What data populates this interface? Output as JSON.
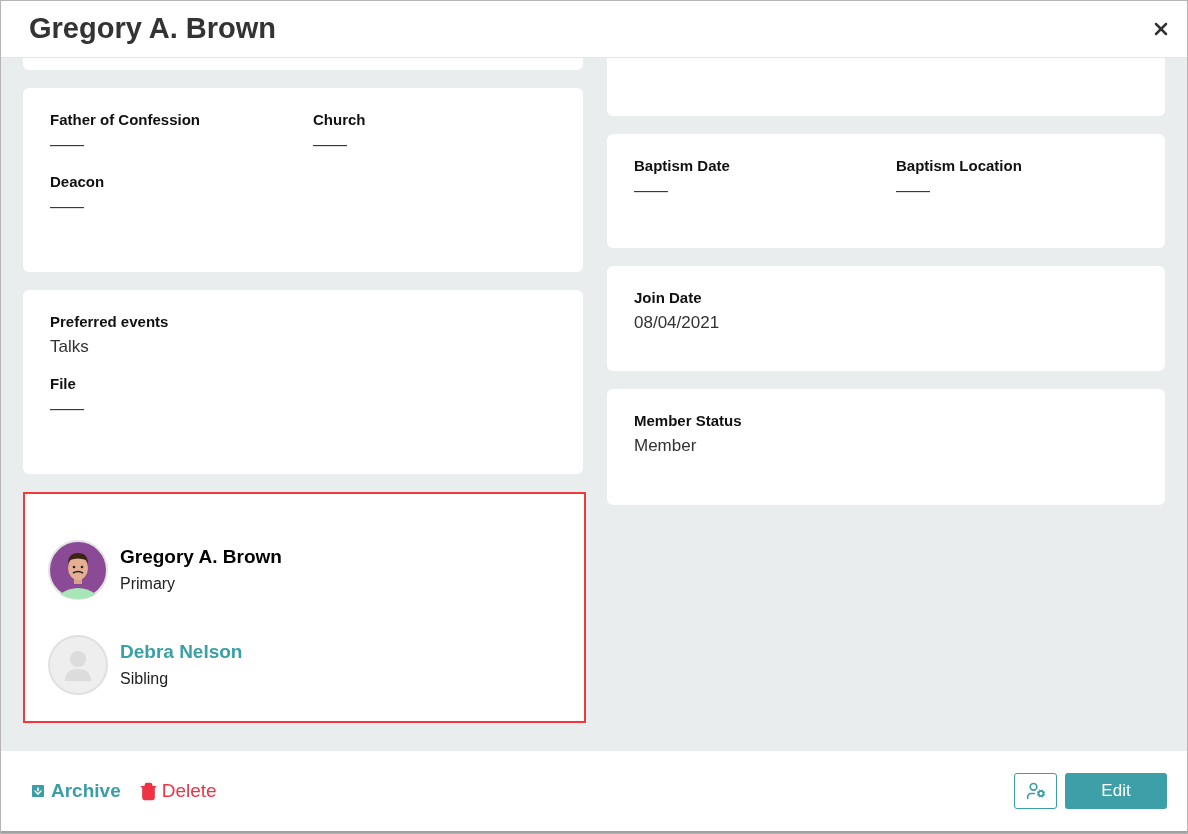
{
  "title": "Gregory A. Brown",
  "left_cards": [
    {
      "rows": [
        [
          {
            "label": "Father of Confession",
            "value": "——"
          },
          {
            "label": "Church",
            "value": "——"
          }
        ],
        [
          {
            "label": "Deacon",
            "value": "——"
          }
        ]
      ]
    },
    {
      "rows": [
        [
          {
            "label": "Preferred events",
            "value": "Talks"
          }
        ],
        [
          {
            "label": "File",
            "value": "——"
          }
        ]
      ]
    }
  ],
  "family": {
    "highlighted": true,
    "members": [
      {
        "name": "Gregory A. Brown",
        "relation": "Primary",
        "kind": "illustrated",
        "link": false
      },
      {
        "name": "Debra Nelson",
        "relation": "Sibling",
        "kind": "placeholder",
        "link": true
      }
    ]
  },
  "right_cards": [
    {
      "rows": [
        [
          {
            "label": "Baptism Date",
            "value": "——"
          },
          {
            "label": "Baptism Location",
            "value": "——"
          }
        ]
      ]
    },
    {
      "rows": [
        [
          {
            "label": "Join Date",
            "value": "08/04/2021"
          }
        ]
      ]
    },
    {
      "rows": [
        [
          {
            "label": "Member Status",
            "value": "Member"
          }
        ]
      ]
    }
  ],
  "footer": {
    "archive": "Archive",
    "delete": "Delete",
    "edit": "Edit"
  }
}
